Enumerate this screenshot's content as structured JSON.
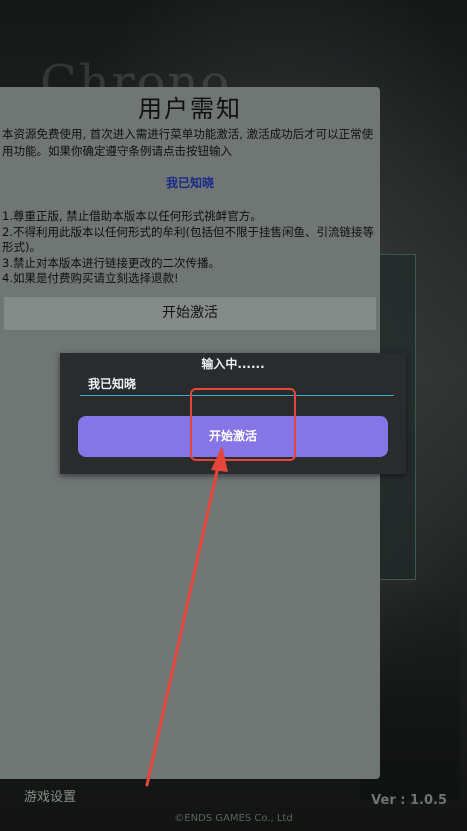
{
  "background": {
    "title": "Chrono",
    "game_settings": "游戏设置",
    "version": "Ver : 1.0.5",
    "copyright": "©ENDS GAMES Co., Ltd"
  },
  "notice": {
    "title": "用户需知",
    "intro": "本资源免费使用, 首次进入需进行菜单功能激活, 激活成功后才可以正常使用功能。如果你确定遵守条例请点击按钮输入",
    "ack_text": "我已知晓",
    "rules": [
      "1.尊重正版, 禁止借助本版本以任何形式祧衅官方。",
      "2.不得利用此版本以任何形式的牟利(包括但不限于挂售闲鱼、引流链接等形式)。",
      "3.禁止对本版本进行链接更改的二次传播。",
      "4.如果是付费购买请立刻选择退款!"
    ],
    "start_button": "开始激活"
  },
  "dialog": {
    "title": "输入中......",
    "input_value": "我已知晓",
    "button": "开始激活"
  },
  "colors": {
    "accent_button": "#8575e6",
    "input_underline": "#3fa7c9",
    "annotation": "#e6453a"
  }
}
